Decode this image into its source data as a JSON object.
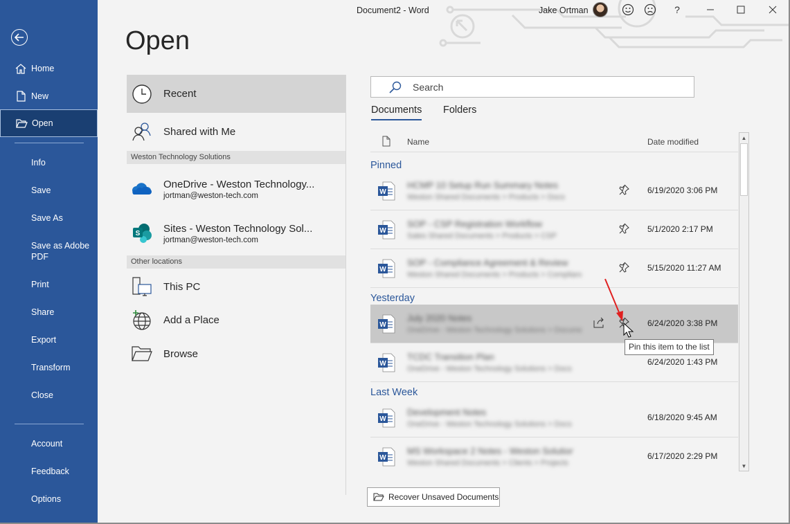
{
  "window": {
    "title": "Document2  -  Word",
    "user_name": "Jake Ortman",
    "help_label": "?"
  },
  "sidebar": {
    "items": [
      {
        "label": "Home"
      },
      {
        "label": "New"
      },
      {
        "label": "Open"
      },
      {
        "label": "Info"
      },
      {
        "label": "Save"
      },
      {
        "label": "Save As"
      },
      {
        "label": "Save as Adobe PDF"
      },
      {
        "label": "Print"
      },
      {
        "label": "Share"
      },
      {
        "label": "Export"
      },
      {
        "label": "Transform"
      },
      {
        "label": "Close"
      },
      {
        "label": "Account"
      },
      {
        "label": "Feedback"
      },
      {
        "label": "Options"
      }
    ],
    "save_as_pdf_line1": "Save as Adobe",
    "save_as_pdf_line2": "PDF"
  },
  "page": {
    "heading": "Open"
  },
  "locations": {
    "recent": "Recent",
    "shared": "Shared with Me",
    "org_section": "Weston Technology Solutions",
    "onedrive_label": "OneDrive - Weston Technology...",
    "onedrive_email": "jortman@weston-tech.com",
    "sites_label": "Sites - Weston Technology Sol...",
    "sites_email": "jortman@weston-tech.com",
    "other_section": "Other locations",
    "this_pc": "This PC",
    "add_place": "Add a Place",
    "browse": "Browse"
  },
  "search": {
    "placeholder": "Search"
  },
  "tabs": {
    "documents": "Documents",
    "folders": "Folders"
  },
  "list": {
    "col_name": "Name",
    "col_date": "Date modified",
    "groups": {
      "pinned": "Pinned",
      "yesterday": "Yesterday",
      "last_week": "Last Week"
    },
    "rows": [
      {
        "name": "HCMP 10 Setup Run Summary Notes",
        "path": "Weston Shared Documents > Products > Docs",
        "date": "6/19/2020 3:06 PM"
      },
      {
        "name": "SOP - CSP Registration Workflow",
        "path": "Sales Shared Documents > Products > CSP",
        "date": "5/1/2020 2:17 PM"
      },
      {
        "name": "SOP - Compliance Agreement & Review",
        "path": "Weston Shared Documents > Products > Compliance",
        "date": "5/15/2020 11:27 AM"
      },
      {
        "name": "July 2020 Notes",
        "path": "OneDrive - Weston Technology Solutions > Documents",
        "date": "6/24/2020 3:38 PM"
      },
      {
        "name": "TCDC Transition Plan",
        "path": "OneDrive - Weston Technology Solutions > Docs",
        "date": "6/24/2020 1:43 PM"
      },
      {
        "name": "Development Notes",
        "path": "OneDrive - Weston Technology Solutions > Docs",
        "date": "6/18/2020 9:45 AM"
      },
      {
        "name": "MS Workspace 2 Notes - Weston Solutions",
        "path": "Weston Shared Documents > Clients > Projects",
        "date": "6/17/2020 2:29 PM"
      }
    ]
  },
  "tooltip": "Pin this item to the list",
  "recover_button": "Recover Unsaved Documents",
  "colors": {
    "sidebar": "#2b579a",
    "sidebar_active": "#1a3f72",
    "accent": "#2b579a",
    "row_hover": "#c8c8c8",
    "annotation_arrow": "#e02020"
  },
  "icons": {
    "back": "back-arrow-icon",
    "home": "home-icon",
    "new": "new-document-icon",
    "open": "open-folder-icon",
    "recent": "clock-icon",
    "shared": "people-icon",
    "onedrive": "onedrive-cloud-icon",
    "sites": "sharepoint-sites-icon",
    "this_pc": "computer-icon",
    "add_place": "globe-plus-icon",
    "browse": "folder-icon",
    "search": "search-icon",
    "pin": "pin-icon",
    "share": "share-icon",
    "word_doc": "word-document-icon"
  }
}
